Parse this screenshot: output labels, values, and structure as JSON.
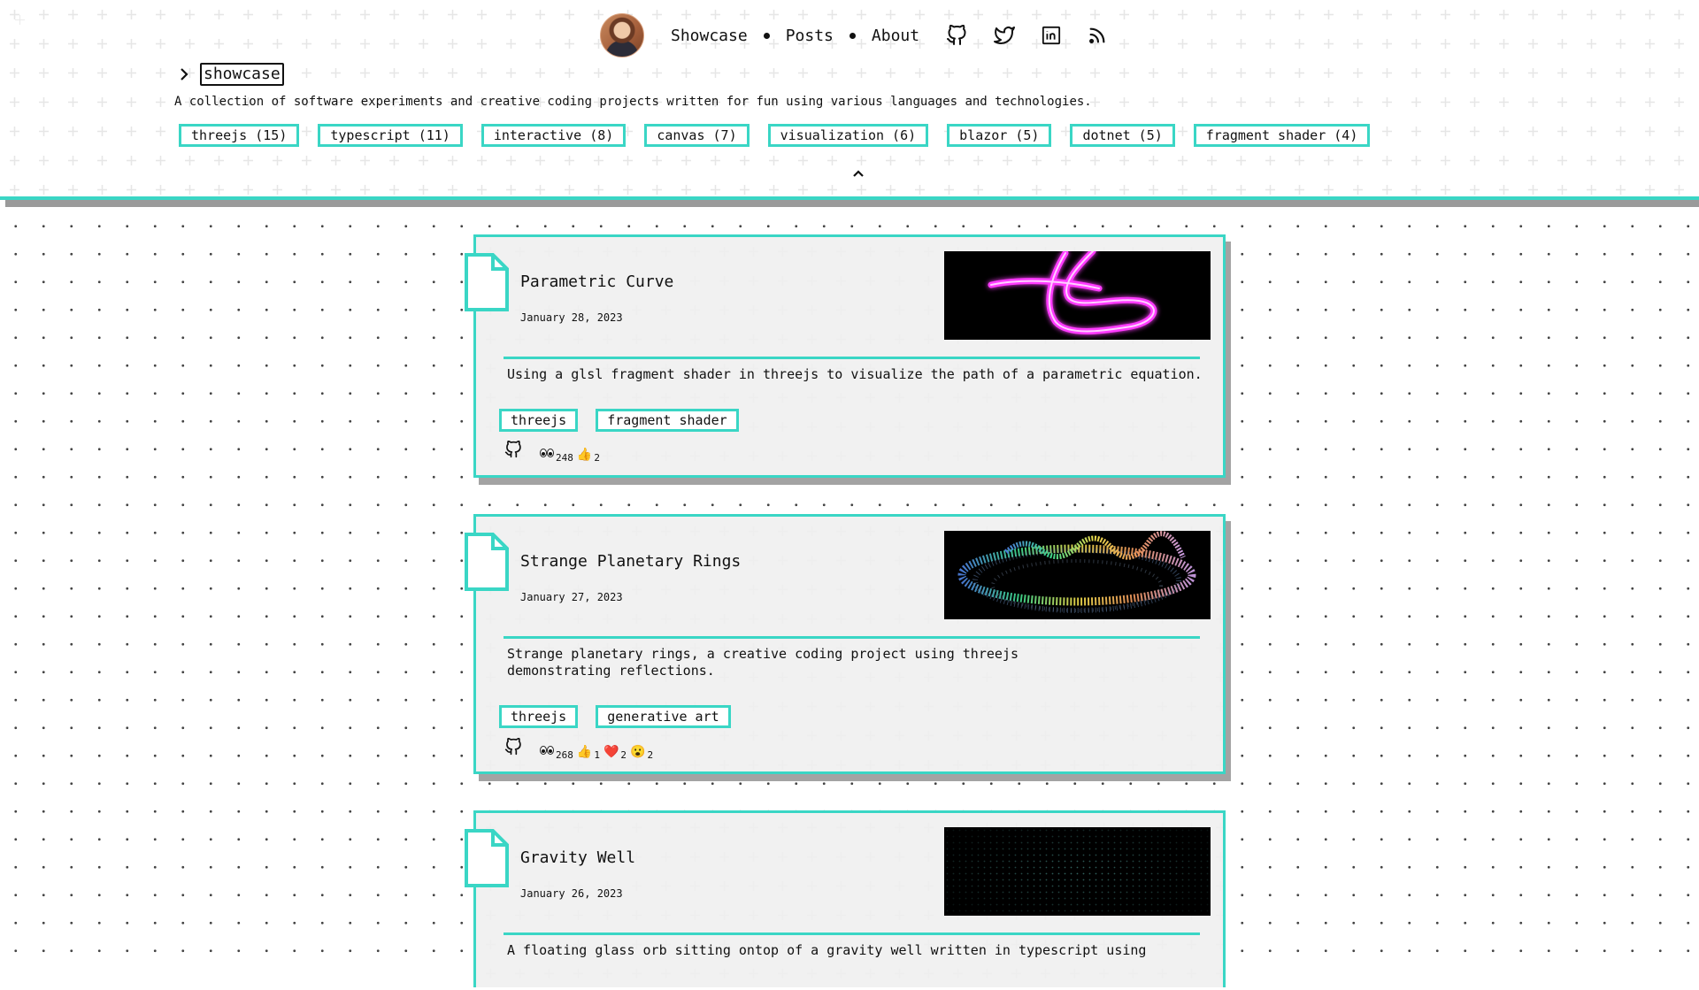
{
  "nav": {
    "links": [
      "Showcase",
      "Posts",
      "About"
    ],
    "social": [
      "github-icon",
      "twitter-icon",
      "linkedin-icon",
      "rss-icon"
    ]
  },
  "breadcrumb": {
    "label": "showcase"
  },
  "subtitle": "A collection of software experiments and creative coding projects written for fun using various languages and technologies.",
  "tags": [
    "threejs (15)",
    "typescript (11)",
    "interactive (8)",
    "canvas (7)",
    "visualization (6)",
    "blazor (5)",
    "dotnet (5)",
    "fragment shader (4)"
  ],
  "posts": [
    {
      "title": "Parametric Curve",
      "date": "January 28, 2023",
      "description": "Using a glsl fragment shader in threejs to visualize the path of a parametric equation.",
      "tags": [
        "threejs",
        "fragment shader"
      ],
      "views": "248",
      "reactions": [
        {
          "emoji": "👍",
          "count": "2"
        }
      ]
    },
    {
      "title": "Strange Planetary Rings",
      "date": "January 27, 2023",
      "description": "Strange planetary rings, a creative coding project using threejs demonstrating reflections.",
      "tags": [
        "threejs",
        "generative art"
      ],
      "views": "268",
      "reactions": [
        {
          "emoji": "👍",
          "count": "1"
        },
        {
          "emoji": "❤️",
          "count": "2"
        },
        {
          "emoji": "😮",
          "count": "2"
        }
      ]
    },
    {
      "title": "Gravity Well",
      "date": "January 26, 2023",
      "description": "A floating glass orb sitting ontop of a gravity well written in typescript using"
    }
  ],
  "colors": {
    "accent": "#3ad6c5",
    "shadow": "#a3a3a3"
  }
}
